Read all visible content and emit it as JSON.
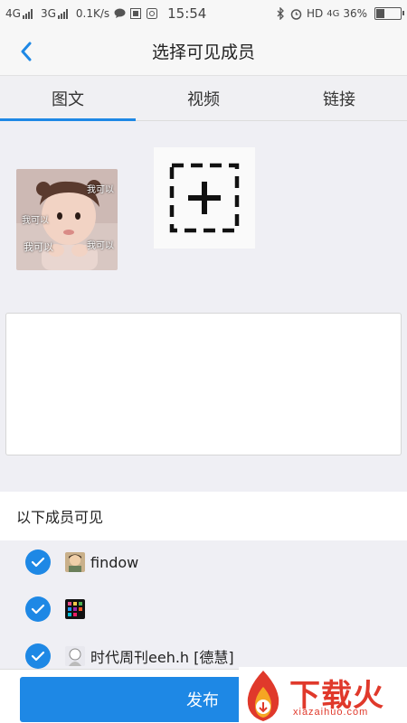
{
  "status_bar": {
    "network1": "4G",
    "network2": "3G",
    "speed": "0.1K/s",
    "time": "15:54",
    "hd": "HD",
    "network3": "4G",
    "battery_percent": "36%",
    "battery_level": 0.36
  },
  "nav": {
    "title": "选择可见成员",
    "back_icon": "chevron-left-icon"
  },
  "tabs": [
    {
      "label": "图文",
      "active": true
    },
    {
      "label": "视频",
      "active": false
    },
    {
      "label": "链接",
      "active": false
    }
  ],
  "media": {
    "photo_captions": [
      "我可以",
      "我可以",
      "我可以",
      "我可以"
    ],
    "add_icon": "add-media-icon"
  },
  "text_input": {
    "value": "",
    "placeholder": ""
  },
  "members": {
    "header": "以下成员可见",
    "items": [
      {
        "name": "findow",
        "checked": true
      },
      {
        "name": "",
        "checked": true
      },
      {
        "name": "时代周刊eeh.h [德慧]",
        "checked": true
      }
    ]
  },
  "publish_label": "发布",
  "watermark": {
    "text": "下载火",
    "url": "xiazaihuo.com"
  },
  "colors": {
    "accent": "#1e88e5",
    "watermark": "#e0392b"
  }
}
